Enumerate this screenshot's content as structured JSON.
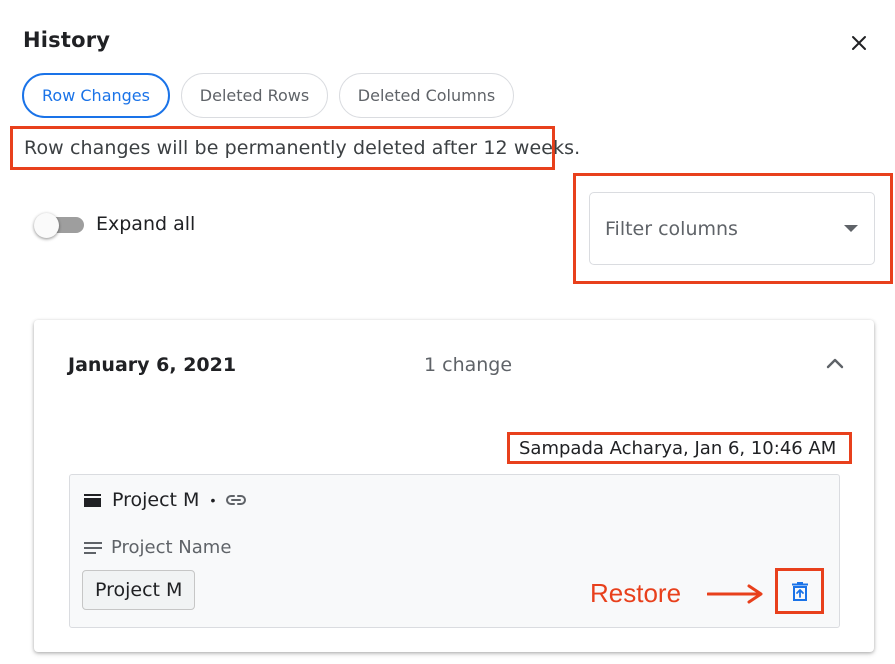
{
  "dialog": {
    "title": "History"
  },
  "tabs": [
    {
      "label": "Row Changes",
      "active": true
    },
    {
      "label": "Deleted Rows",
      "active": false
    },
    {
      "label": "Deleted Columns",
      "active": false
    }
  ],
  "notice": "Row changes will be permanently deleted after 12 weeks.",
  "expand_all": {
    "label": "Expand all",
    "checked": false
  },
  "filter": {
    "placeholder": "Filter columns"
  },
  "history_group": {
    "date": "January 6, 2021",
    "change_count": "1 change",
    "expanded": true,
    "entry": {
      "author_time": "Sampada Acharya, Jan 6, 10:46 AM",
      "row_label": "Project M",
      "separator": "•",
      "field_name": "Project Name",
      "value": "Project M"
    }
  },
  "annotations": {
    "restore_label": "Restore",
    "highlight_color": "#e8401c"
  },
  "colors": {
    "accent": "#1a73e8",
    "text_primary": "#202124",
    "text_secondary": "#5f6368",
    "border": "#dadce0"
  },
  "icons": [
    "close-icon",
    "chevron-up-icon",
    "dropdown-arrow-icon",
    "row-icon",
    "link-icon",
    "text-lines-icon",
    "restore-icon",
    "arrow-right-icon"
  ]
}
